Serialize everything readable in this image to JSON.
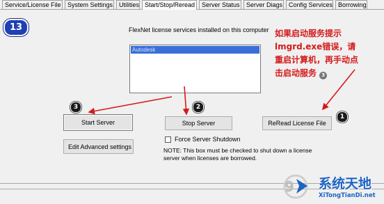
{
  "tabs": [
    {
      "label": "Service/License File",
      "active": false
    },
    {
      "label": "System Settings",
      "active": false
    },
    {
      "label": "Utilities",
      "active": false
    },
    {
      "label": "Start/Stop/Reread",
      "active": true
    },
    {
      "label": "Server Status",
      "active": false
    },
    {
      "label": "Server Diags",
      "active": false
    },
    {
      "label": "Config Services",
      "active": false
    },
    {
      "label": "Borrowing",
      "active": false
    }
  ],
  "step_badge": "13",
  "services": {
    "heading": "FlexNet license services installed on this computer",
    "items": [
      "Autodesk"
    ]
  },
  "buttons": {
    "start_server": "Start Server",
    "stop_server": "Stop Server",
    "reread": "ReRead License File",
    "edit_advanced": "Edit Advanced settings"
  },
  "force_shutdown": {
    "label": "Force Server Shutdown",
    "checked": false
  },
  "note": "NOTE:  This box must be checked to shut down a license server when licenses are borrowed.",
  "annotation": {
    "text": "如果启动服务提示lmgrd.exe错误，请重启计算机，再手动点击启动服务",
    "color": "#d41a1a",
    "marker": "3"
  },
  "step_markers": [
    "3",
    "2",
    "1"
  ],
  "watermark": {
    "title": "系统天地",
    "url": "XiTongTianDi.net"
  },
  "colors": {
    "arrow": "#d41a1a",
    "badge": "#1f3fb5",
    "watermark": "#1c63c4"
  }
}
